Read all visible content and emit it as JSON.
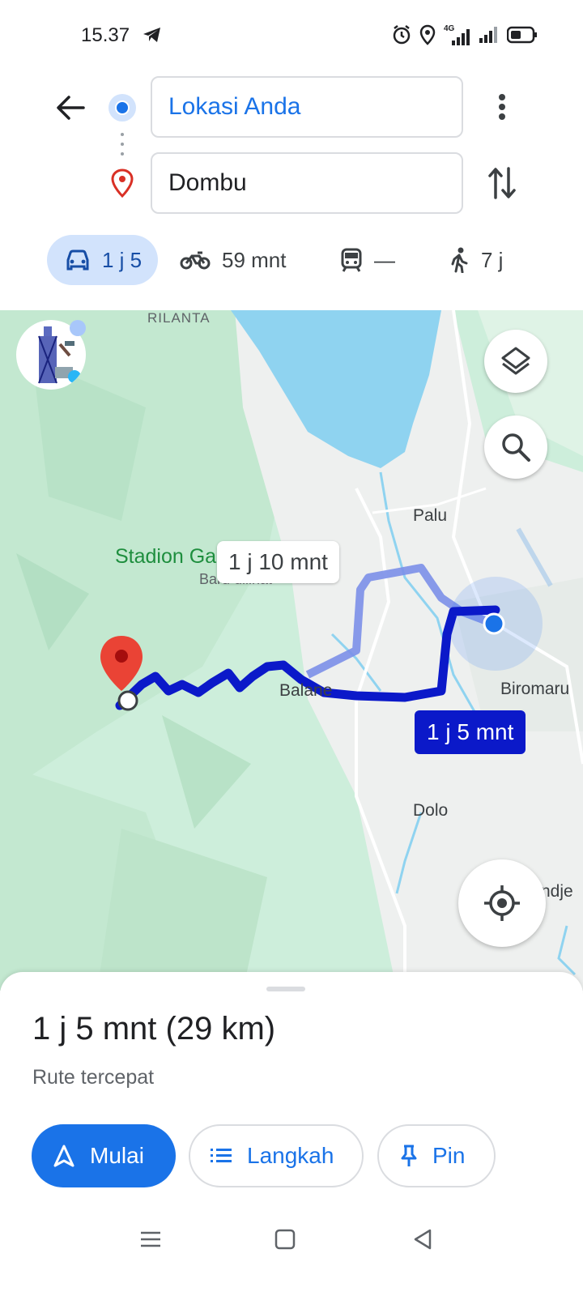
{
  "status_bar": {
    "time": "15.37",
    "network_badge": "4G"
  },
  "header": {
    "origin": "Lokasi Anda",
    "destination": "Dombu"
  },
  "modes": {
    "car": "1 j 5",
    "bike": "59 mnt",
    "transit": "—",
    "walk": "7 j"
  },
  "map": {
    "labels": {
      "rilanta": "RILANTA",
      "palu": "Palu",
      "stadion": "Stadion Ga",
      "baru": "Baru dilihat",
      "balane": "Balane",
      "biromaru": "Biromaru",
      "dolo": "Dolo",
      "ndje": "ndje"
    },
    "route_alt_time": "1 j 10 mnt",
    "route_main_time": "1 j 5 mnt",
    "colors": {
      "route": "#0b19c9",
      "route_alt": "#7b8fe8",
      "water": "#8fd3f0",
      "land": "#cdeedb"
    }
  },
  "sheet": {
    "title": "1 j 5 mnt (29 km)",
    "subtitle": "Rute tercepat",
    "start_label": "Mulai",
    "steps_label": "Langkah",
    "pin_label": "Pin"
  }
}
